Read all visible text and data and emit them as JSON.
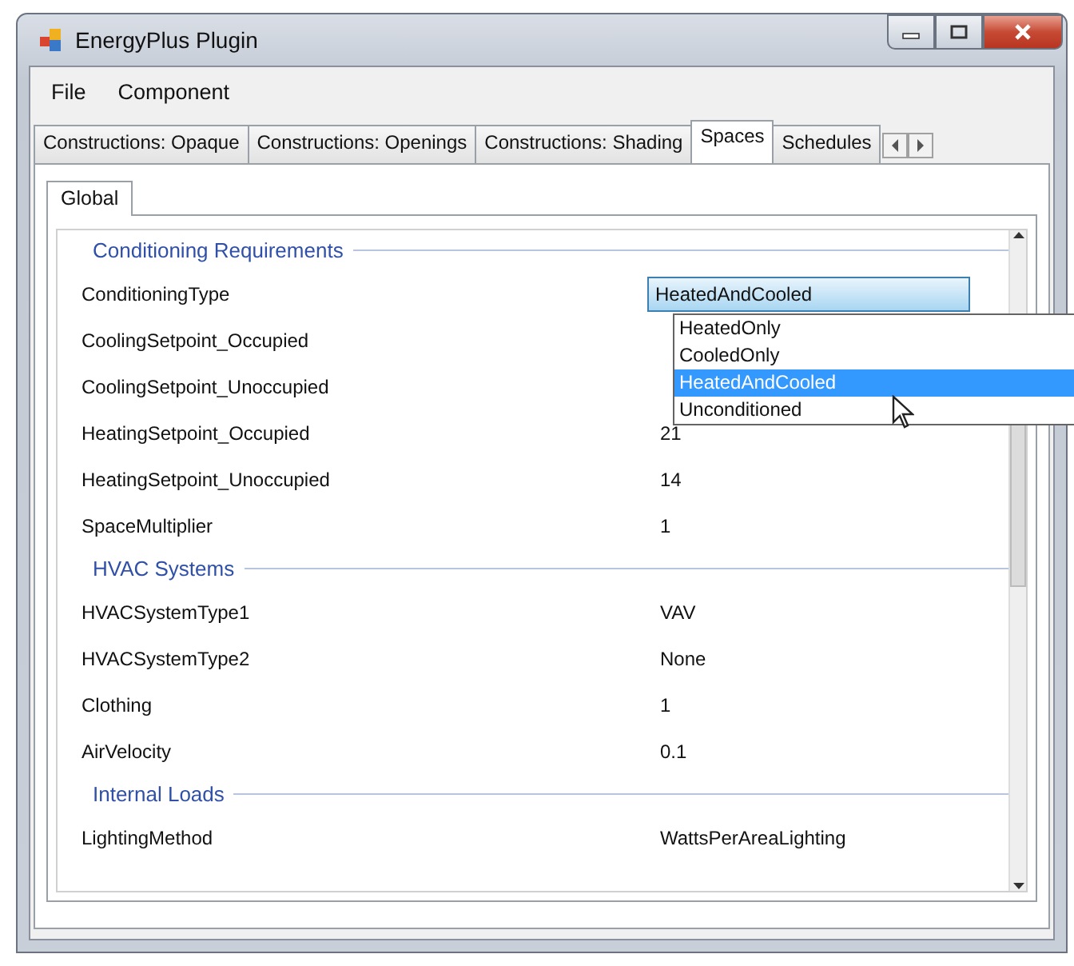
{
  "window": {
    "title": "EnergyPlus Plugin"
  },
  "menu": [
    "File",
    "Component"
  ],
  "tabs": [
    {
      "label": "Constructions: Opaque",
      "selected": false
    },
    {
      "label": "Constructions: Openings",
      "selected": false
    },
    {
      "label": "Constructions: Shading",
      "selected": false
    },
    {
      "label": "Spaces",
      "selected": true
    },
    {
      "label": "Schedules",
      "selected": false
    }
  ],
  "subtabs": [
    {
      "label": "Global",
      "selected": true
    }
  ],
  "sections": [
    {
      "category": "Conditioning Requirements",
      "properties": [
        {
          "name": "ConditioningType",
          "value": "HeatedAndCooled",
          "kind": "combo",
          "options": [
            {
              "label": "HeatedOnly",
              "selected": false
            },
            {
              "label": "CooledOnly",
              "selected": false
            },
            {
              "label": "HeatedAndCooled",
              "selected": true
            },
            {
              "label": "Unconditioned",
              "selected": false
            }
          ]
        },
        {
          "name": "CoolingSetpoint_Occupied",
          "kind": "text"
        },
        {
          "name": "CoolingSetpoint_Unoccupied",
          "kind": "text"
        },
        {
          "name": "HeatingSetpoint_Occupied",
          "value": "21",
          "kind": "text"
        },
        {
          "name": "HeatingSetpoint_Unoccupied",
          "value": "14",
          "kind": "text"
        },
        {
          "name": "SpaceMultiplier",
          "value": "1",
          "kind": "text"
        }
      ]
    },
    {
      "category": "HVAC Systems",
      "properties": [
        {
          "name": "HVACSystemType1",
          "value": "VAV",
          "kind": "text"
        },
        {
          "name": "HVACSystemType2",
          "value": "None",
          "kind": "text"
        },
        {
          "name": "Clothing",
          "value": "1",
          "kind": "text"
        },
        {
          "name": "AirVelocity",
          "value": "0.1",
          "kind": "text"
        }
      ]
    },
    {
      "category": "Internal Loads",
      "properties": [
        {
          "name": "LightingMethod",
          "value": "WattsPerAreaLighting",
          "kind": "text"
        }
      ]
    }
  ]
}
